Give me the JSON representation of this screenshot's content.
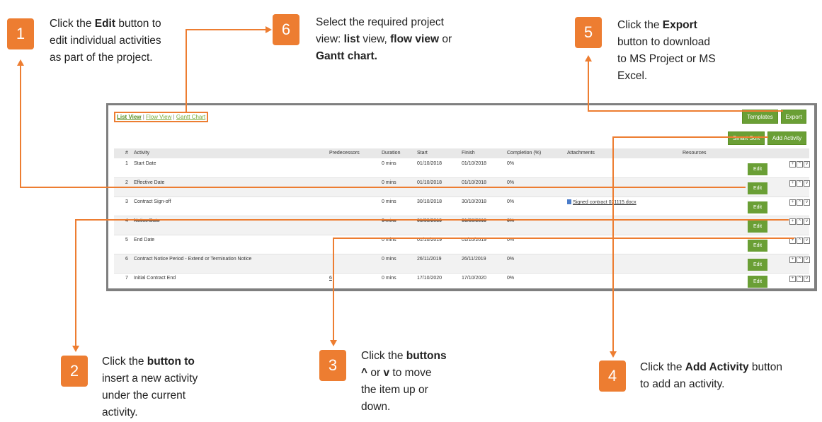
{
  "callouts": [
    {
      "num": "1",
      "lines": [
        [
          "Click the ",
          "Edit",
          " button to"
        ],
        [
          "edit individual activities"
        ],
        [
          "as part of the project."
        ]
      ]
    },
    {
      "num": "2",
      "lines": [
        [
          "Click the ",
          "button to"
        ],
        [
          "insert a new activity"
        ],
        [
          "under the current"
        ],
        [
          "activity."
        ]
      ]
    },
    {
      "num": "3",
      "lines": [
        [
          "Click the ",
          "buttons"
        ],
        [
          "^",
          " or ",
          "v",
          " to move"
        ],
        [
          "the item up or"
        ],
        [
          "down."
        ]
      ]
    },
    {
      "num": "4",
      "lines": [
        [
          "Click the ",
          "Add Activity",
          " button"
        ],
        [
          "to add an activity."
        ]
      ]
    },
    {
      "num": "5",
      "lines": [
        [
          "Click the ",
          "Export"
        ],
        [
          "button to download"
        ],
        [
          "to MS Project or MS"
        ],
        [
          "Excel."
        ]
      ]
    },
    {
      "num": "6",
      "lines": [
        [
          "Select the required project"
        ],
        [
          "view: ",
          "list",
          " view, ",
          "flow view",
          " or"
        ],
        [
          "Gantt chart."
        ]
      ]
    }
  ],
  "view_tabs": {
    "list": "List View",
    "sep": " | ",
    "flow": "Flow View",
    "gantt": "Gantt Chart"
  },
  "toolbar": {
    "templates": "Templates",
    "export": "Export",
    "smart_sort": "Smart Sort",
    "add_activity": "Add Activity"
  },
  "table": {
    "headers": {
      "num": "#",
      "activity": "Activity",
      "predecessors": "Predecessors",
      "duration": "Duration",
      "start": "Start",
      "finish": "Finish",
      "completion": "Completion (%)",
      "attachments": "Attachments",
      "resources": "Resources"
    },
    "rows": [
      {
        "num": "1",
        "activity": "Start Date",
        "predecessors": "",
        "duration": "0 mins",
        "start": "01/10/2018",
        "finish": "01/10/2018",
        "completion": "0%",
        "attachment": "",
        "edit": "Edit"
      },
      {
        "num": "2",
        "activity": "Effective Date",
        "predecessors": "",
        "duration": "0 mins",
        "start": "01/10/2018",
        "finish": "01/10/2018",
        "completion": "0%",
        "attachment": "",
        "edit": "Edit"
      },
      {
        "num": "3",
        "activity": "Contract Sign-off",
        "predecessors": "",
        "duration": "0 mins",
        "start": "30/10/2018",
        "finish": "30/10/2018",
        "completion": "0%",
        "attachment": "Signed contract 021115.docx",
        "edit": "Edit"
      },
      {
        "num": "4",
        "activity": "Notice Date",
        "predecessors": "",
        "duration": "0 mins",
        "start": "01/08/2019",
        "finish": "01/08/2019",
        "completion": "0%",
        "attachment": "",
        "edit": "Edit"
      },
      {
        "num": "5",
        "activity": "End Date",
        "predecessors": "",
        "duration": "0 mins",
        "start": "01/10/2019",
        "finish": "01/10/2019",
        "completion": "0%",
        "attachment": "",
        "edit": "Edit"
      },
      {
        "num": "6",
        "activity": "Contract Notice Period - Extend or Termination Notice",
        "predecessors": "",
        "duration": "0 mins",
        "start": "26/11/2019",
        "finish": "26/11/2019",
        "completion": "0%",
        "attachment": "",
        "edit": "Edit"
      },
      {
        "num": "7",
        "activity": "Initial Contract End",
        "predecessors": "6",
        "duration": "0 mins",
        "start": "17/10/2020",
        "finish": "17/10/2020",
        "completion": "0%",
        "attachment": "",
        "edit": "Edit"
      }
    ]
  },
  "colors": {
    "accent": "#ed7d31",
    "button_green": "#6a9f35"
  }
}
